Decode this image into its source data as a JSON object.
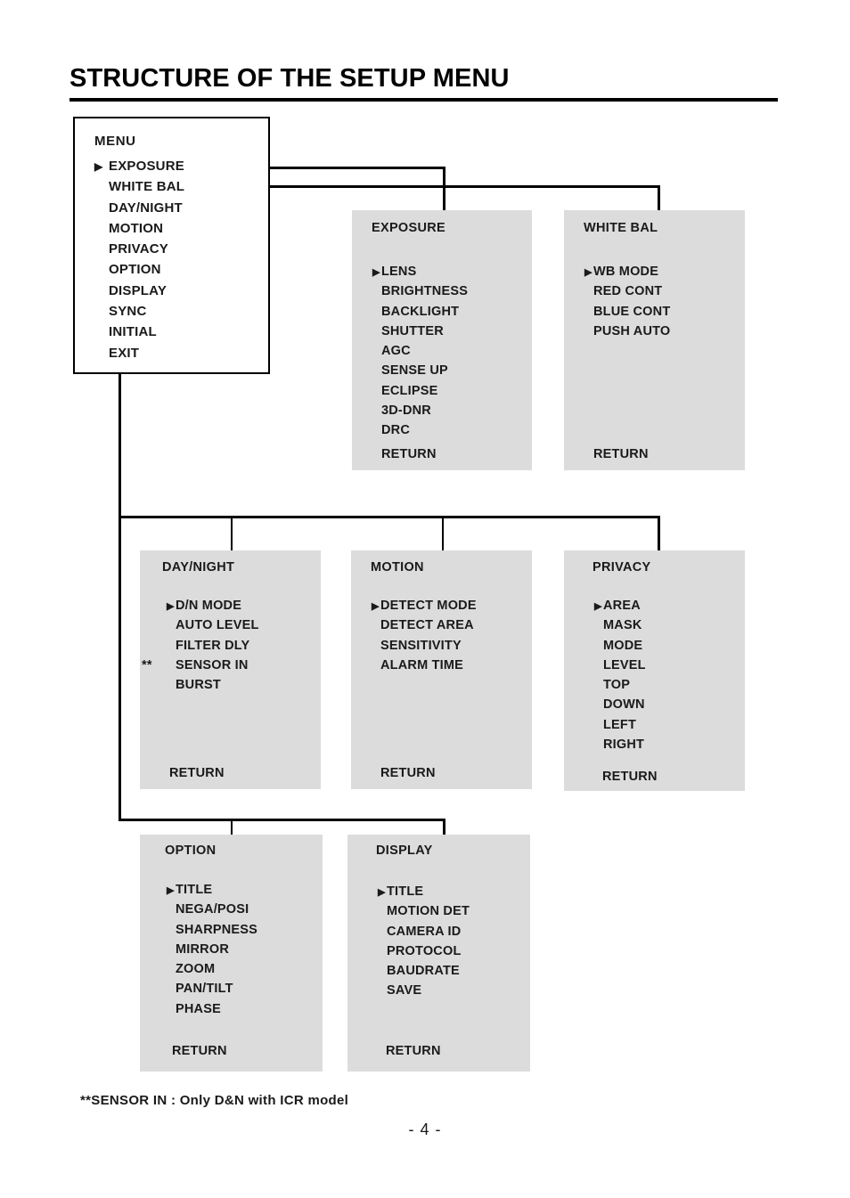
{
  "page": {
    "title": "STRUCTURE OF THE SETUP MENU",
    "footnote": "**SENSOR IN : Only D&N with ICR model",
    "folio": "- 4 -",
    "colors": {
      "panel_background": "#dcdcdc",
      "line": "#000000",
      "text": "#1a1a1a",
      "page_background": "#ffffff"
    }
  },
  "caret": "▶",
  "menu": {
    "title": "MENU",
    "items": [
      {
        "label": "EXPOSURE",
        "selected": true
      },
      {
        "label": "WHITE BAL",
        "selected": false
      },
      {
        "label": "DAY/NIGHT",
        "selected": false
      },
      {
        "label": "MOTION",
        "selected": false
      },
      {
        "label": "PRIVACY",
        "selected": false
      },
      {
        "label": "OPTION",
        "selected": false
      },
      {
        "label": "DISPLAY",
        "selected": false
      },
      {
        "label": "SYNC",
        "selected": false
      },
      {
        "label": "INITIAL",
        "selected": false
      },
      {
        "label": "EXIT",
        "selected": false
      }
    ]
  },
  "panels": {
    "exposure": {
      "title": "EXPOSURE",
      "items": [
        "LENS",
        "BRIGHTNESS",
        "BACKLIGHT",
        "SHUTTER",
        "AGC",
        "SENSE UP",
        "ECLIPSE",
        "3D-DNR",
        "DRC"
      ],
      "return_label": "RETURN"
    },
    "white_bal": {
      "title": "WHITE BAL",
      "items": [
        "WB MODE",
        "RED CONT",
        "BLUE CONT",
        "PUSH AUTO"
      ],
      "return_label": "RETURN"
    },
    "day_night": {
      "title": "DAY/NIGHT",
      "items": [
        "D/N MODE",
        "AUTO LEVEL",
        "FILTER DLY",
        "SENSOR  IN",
        "BURST"
      ],
      "footnote_marker": "**",
      "footnote_marker_item": "SENSOR  IN",
      "return_label": "RETURN"
    },
    "motion": {
      "title": "MOTION",
      "items": [
        "DETECT MODE",
        "DETECT AREA",
        "SENSITIVITY",
        "ALARM TIME"
      ],
      "return_label": "RETURN"
    },
    "privacy": {
      "title": "PRIVACY",
      "items": [
        "AREA",
        "MASK",
        "MODE",
        "LEVEL",
        "TOP",
        "DOWN",
        "LEFT",
        "RIGHT"
      ],
      "return_label": "RETURN"
    },
    "option": {
      "title": "OPTION",
      "items": [
        "TITLE",
        "NEGA/POSI",
        "SHARPNESS",
        "MIRROR",
        "ZOOM",
        "PAN/TILT",
        "PHASE"
      ],
      "return_label": "RETURN"
    },
    "display": {
      "title": "DISPLAY",
      "items": [
        "TITLE",
        "MOTION DET",
        "CAMERA ID",
        "PROTOCOL",
        "BAUDRATE",
        "SAVE"
      ],
      "return_label": "RETURN"
    }
  }
}
